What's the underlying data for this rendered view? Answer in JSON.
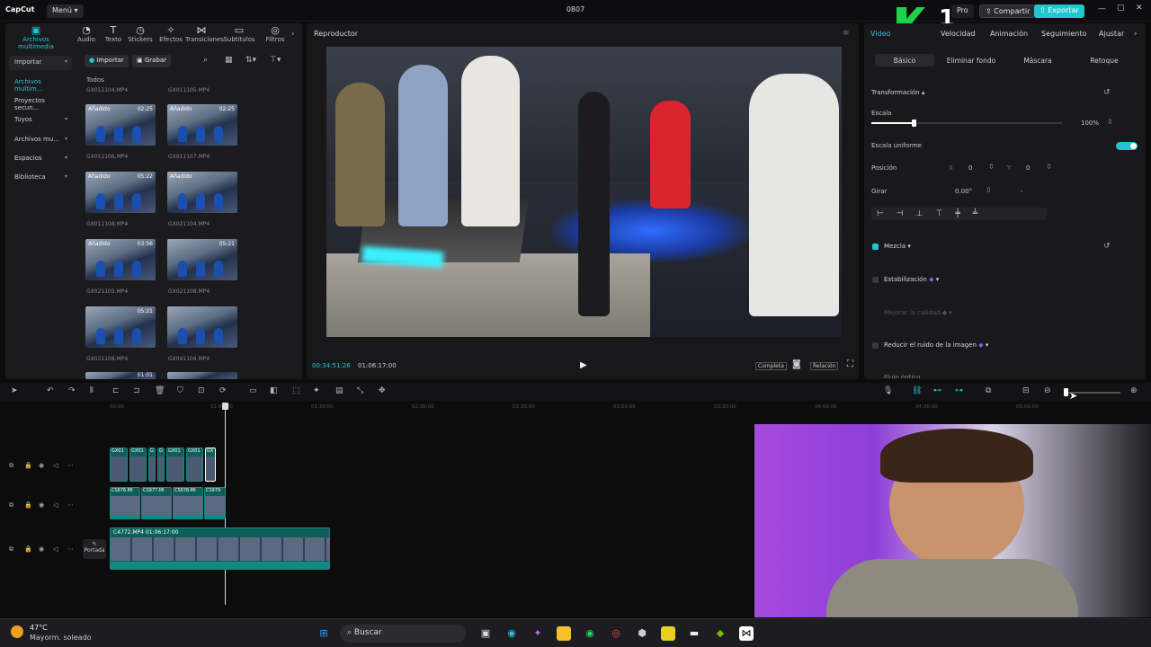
{
  "app": {
    "logo": "CapCut",
    "menu_label": "Menú",
    "project_title": "0807"
  },
  "top_actions": {
    "pro": "Pro",
    "share": "Compartir",
    "export": "Exportar",
    "overlay_badge": "1"
  },
  "toolbar": [
    {
      "label": "Archivos multimedia",
      "icon": "media-icon",
      "glyph": "▣"
    },
    {
      "label": "Audio",
      "icon": "audio-icon",
      "glyph": "◔"
    },
    {
      "label": "Texto",
      "icon": "text-icon",
      "glyph": "T"
    },
    {
      "label": "Stickers",
      "icon": "sticker-icon",
      "glyph": "◷"
    },
    {
      "label": "Efectos",
      "icon": "effects-icon",
      "glyph": "✧"
    },
    {
      "label": "Transiciones",
      "icon": "transitions-icon",
      "glyph": "⋈"
    },
    {
      "label": "Subtítulos",
      "icon": "subtitles-icon",
      "glyph": "▭"
    },
    {
      "label": "Filtros",
      "icon": "filters-icon",
      "glyph": "◎"
    }
  ],
  "sidebar": [
    {
      "label": "Importar",
      "selected": true
    },
    {
      "label": "Archivos multim...",
      "selected": false
    },
    {
      "label": "Proyectos secun...",
      "selected": false
    },
    {
      "label": "Tuyos",
      "selected": false
    },
    {
      "label": "Archivos mu...",
      "selected": false
    },
    {
      "label": "Espacios",
      "selected": false
    },
    {
      "label": "Biblioteca",
      "selected": false
    }
  ],
  "media_toolbar": {
    "import": "Importar",
    "record": "Grabar"
  },
  "media_filter": "Todos",
  "media_top_names": [
    "GX011104.MP4",
    "GX011105.MP4"
  ],
  "media": [
    {
      "badge": "Añadido",
      "duration": "02:25",
      "name": "GX011106.MP4"
    },
    {
      "badge": "Añadido",
      "duration": "02:25",
      "name": "GX011107.MP4"
    },
    {
      "badge": "Añadido",
      "duration": "05:22",
      "name": "GX011108.MP4"
    },
    {
      "badge": "Añadido",
      "duration": "",
      "name": "GX021104.MP4"
    },
    {
      "badge": "Añadido",
      "duration": "03:56",
      "name": "GX021105.MP4"
    },
    {
      "badge": "",
      "duration": "05:21",
      "name": "GX021108.MP4"
    },
    {
      "badge": "",
      "duration": "05:21",
      "name": "GX031108.MP4"
    },
    {
      "badge": "",
      "duration": "",
      "name": "GX041104.MP4"
    }
  ],
  "media_bottom_duration": "01:01",
  "player": {
    "title": "Reproductor",
    "current_time": "00:34:51:26",
    "total_time": "01:06:17:00",
    "full_label": "Completa",
    "ratio_label": "Relación"
  },
  "right_tabs": [
    "Video",
    "Velocidad",
    "Animación",
    "Seguimiento",
    "Ajustar"
  ],
  "right_subtabs": [
    "Básico",
    "Eliminar fondo",
    "Máscara",
    "Retoque"
  ],
  "props": {
    "transform": "Transformación",
    "scale": "Escala",
    "scale_value": "100%",
    "scale_fraction": 0.22,
    "uniform": "Escala uniforme",
    "position": "Posición",
    "pos_x_label": "X",
    "pos_x": "0",
    "pos_y_label": "Y",
    "pos_y": "0",
    "rotate": "Girar",
    "rotate_value": "0.00°",
    "rotate_dash": "-",
    "blend": "Mezcla",
    "stabilization": "Estabilización",
    "improve_quality": "Mejorar la calidad",
    "noise": "Reducir el ruido de la imagen",
    "optical_flow": "Flujo óptico"
  },
  "ruler": [
    "00:00",
    "01:00:00",
    "01:30:00",
    "02:30:00",
    "02:30:00",
    "03:00:00",
    "03:30:00",
    "04:00:00",
    "04:30:00",
    "05:00:00"
  ],
  "tracks": {
    "track1_clips": [
      "GX01",
      "GX01",
      "G",
      "G",
      "GX01",
      "GX01",
      "GX"
    ],
    "track2_clips": [
      "CS976.MI",
      "CS977.MI",
      "CS978.MI",
      "CS979"
    ],
    "track3_label": "C4772.MP4",
    "track3_duration": "01:06:17:00",
    "cover": "Portada"
  },
  "taskbar": {
    "temp": "47°C",
    "weather": "Mayorm. soleado",
    "search": "Buscar"
  },
  "colors": {
    "accent": "#21c7cf",
    "panel": "#1b1b1e",
    "bg": "#0c0c0d"
  }
}
